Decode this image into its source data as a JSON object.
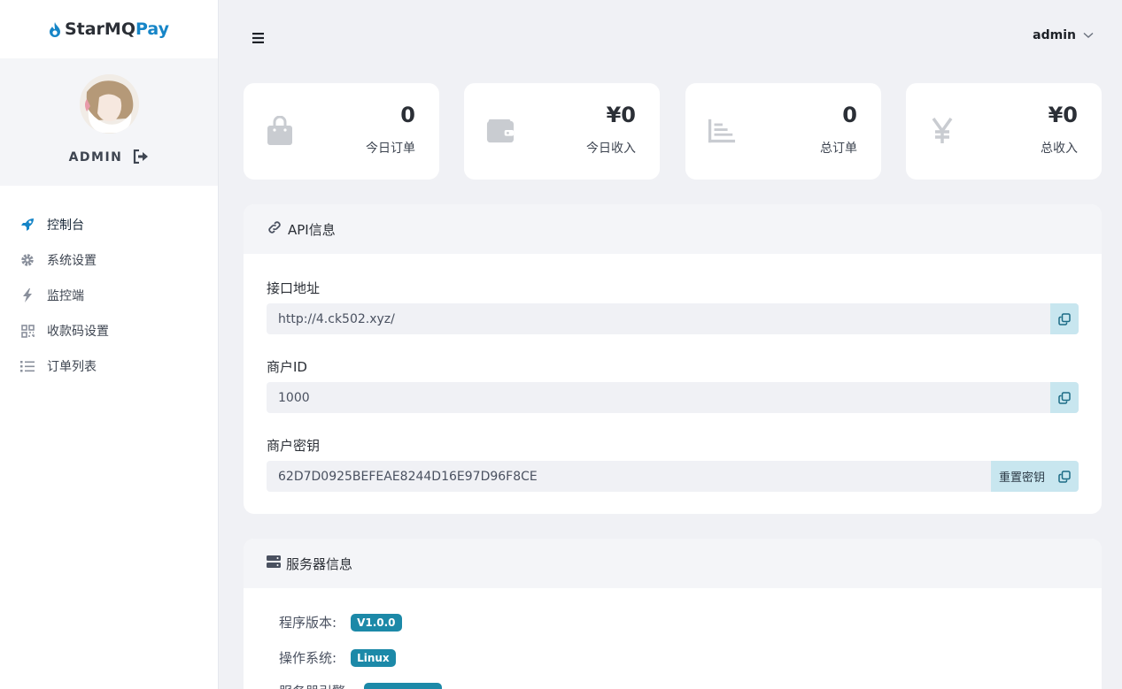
{
  "brand": {
    "part1": "StarMQ",
    "part2": "Pay",
    "icon": "flame-icon"
  },
  "profile": {
    "name": "ADMIN",
    "logout_icon": "logout-icon"
  },
  "nav": [
    {
      "label": "控制台",
      "icon": "rocket-icon",
      "active": true
    },
    {
      "label": "系统设置",
      "icon": "gear-icon"
    },
    {
      "label": "监控端",
      "icon": "bolt-icon"
    },
    {
      "label": "收款码设置",
      "icon": "qrcode-icon"
    },
    {
      "label": "订单列表",
      "icon": "list-icon"
    }
  ],
  "header": {
    "user": "admin"
  },
  "stats": [
    {
      "value": "0",
      "label": "今日订单",
      "icon": "shopping-bag-icon"
    },
    {
      "value": "¥0",
      "label": "今日收入",
      "icon": "wallet-icon"
    },
    {
      "value": "0",
      "label": "总订单",
      "icon": "chart-icon"
    },
    {
      "value": "¥0",
      "label": "总收入",
      "icon": "yen-icon"
    }
  ],
  "api": {
    "title": "API信息",
    "url_label": "接口地址",
    "url_value": "http://4.ck502.xyz/",
    "id_label": "商户ID",
    "id_value": "1000",
    "key_label": "商户密钥",
    "key_value": "62D7D0925BEFEAE8244D16E97D96F8CE",
    "reset_label": "重置密钥"
  },
  "server": {
    "title": "服务器信息",
    "version_label": "程序版本:",
    "version_value": "V1.0.0",
    "os_label": "操作系统:",
    "os_value": "Linux",
    "engine_label": "服务器引擎:",
    "engine_value": ""
  },
  "colors": {
    "accent": "#1685c7",
    "badge": "#1c89a8",
    "copy_bg": "#c8e6ef"
  }
}
